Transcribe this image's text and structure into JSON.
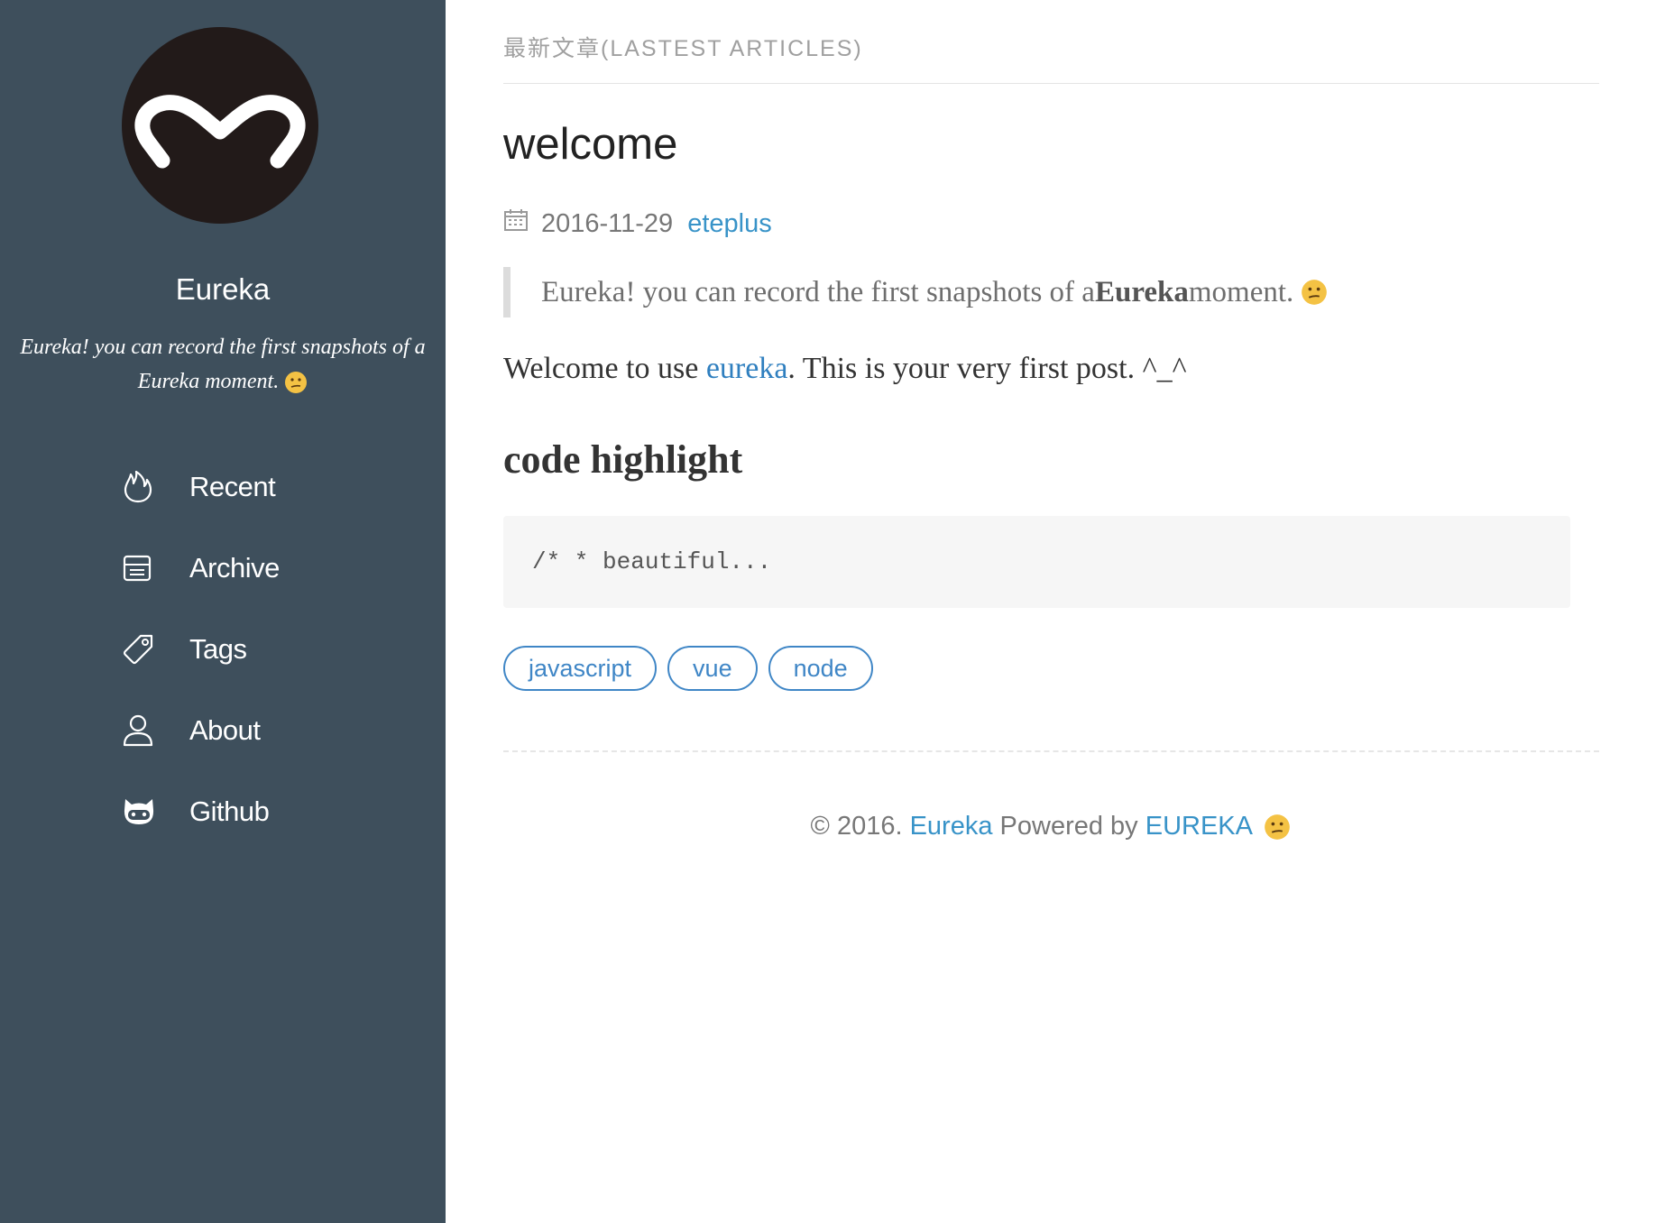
{
  "sidebar": {
    "blog_name": "Eureka",
    "description": "Eureka! you can record the first snapshots of a Eureka moment.",
    "nav": [
      {
        "label": "Recent",
        "icon": "fire-icon"
      },
      {
        "label": "Archive",
        "icon": "archive-icon"
      },
      {
        "label": "Tags",
        "icon": "tag-icon"
      },
      {
        "label": "About",
        "icon": "user-icon"
      },
      {
        "label": "Github",
        "icon": "github-icon"
      }
    ]
  },
  "main": {
    "section_title": "最新文章(LASTEST ARTICLES)",
    "post": {
      "title": "welcome",
      "date": "2016-11-29",
      "author": "eteplus",
      "quote_prefix": "Eureka! you can record the first snapshots of a ",
      "quote_bold": "Eureka",
      "quote_suffix": " moment.",
      "para_prefix": "Welcome to use ",
      "para_link": "eureka",
      "para_suffix": ". This is your very first post. ^_^",
      "heading": "code highlight",
      "code": "/* * beautiful...",
      "tags": [
        "javascript",
        "vue",
        "node"
      ]
    },
    "footer": {
      "prefix": "© 2016. ",
      "site_link": "Eureka",
      "powered": " Powered by ",
      "theme_link": "EUREKA"
    }
  },
  "colors": {
    "sidebar_bg": "#3e4f5c",
    "link": "#3893c8",
    "avatar_bg": "#221a19",
    "emoji": "#f4c244"
  }
}
